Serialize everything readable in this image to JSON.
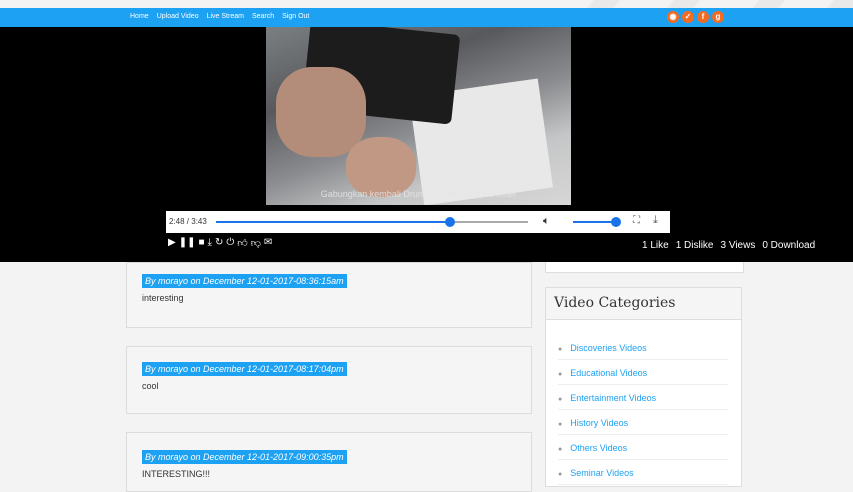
{
  "nav": {
    "links": [
      "Home",
      "Upload Video",
      "Live Stream",
      "Search",
      "Sign Out"
    ],
    "social_icons": [
      "rss-icon",
      "twitter-icon",
      "facebook-icon",
      "google-plus-icon"
    ]
  },
  "player": {
    "subtitle": "Gabungkan kembali Drum Unit dan Tempat toner",
    "time": "2:48 / 3:43",
    "progress_fraction": 0.75,
    "volume_fraction": 0.95,
    "control_icons": [
      "play-icon",
      "pause-icon",
      "stop-icon",
      "download-icon",
      "replay-icon",
      "power-icon",
      "like-icon",
      "dislike-icon",
      "mail-icon"
    ],
    "stats": {
      "likes": "1 Like",
      "dislikes": "1 Dislike",
      "views": "3 Views",
      "downloads": "0 Download"
    }
  },
  "comments": [
    {
      "header": "By morayo on December 12-01-2017-08:36:15am",
      "text": "interesting"
    },
    {
      "header": "By morayo on December 12-01-2017-08:17:04pm",
      "text": "cool"
    },
    {
      "header": "By morayo on December 12-01-2017-09:00:35pm",
      "text": "INTERESTING!!!"
    }
  ],
  "sidebar": {
    "categories_title": "Video Categories",
    "categories": [
      "Discoveries Videos",
      "Educational Videos",
      "Entertainment Videos",
      "History Videos",
      "Others Videos",
      "Seminar Videos"
    ]
  },
  "colors": {
    "accent": "#1da1f2",
    "social": "#f36b21",
    "progress": "#1a73e8"
  }
}
